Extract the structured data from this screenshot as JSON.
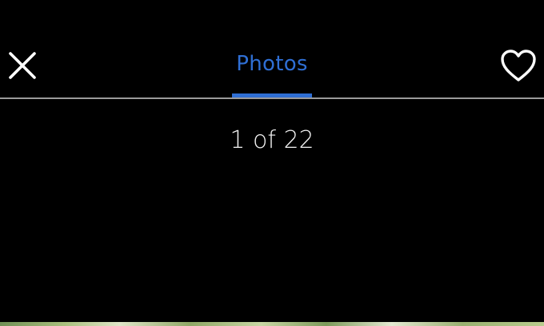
{
  "header": {
    "close_icon": "close-icon",
    "favorite_icon": "heart-outline-icon",
    "tab": {
      "label": "Photos",
      "active": true
    }
  },
  "viewer": {
    "counter": "1 of 22"
  },
  "colors": {
    "background": "#000000",
    "accent": "#2f6fd4",
    "divider": "#9a9a9a",
    "icon": "#ffffff"
  }
}
